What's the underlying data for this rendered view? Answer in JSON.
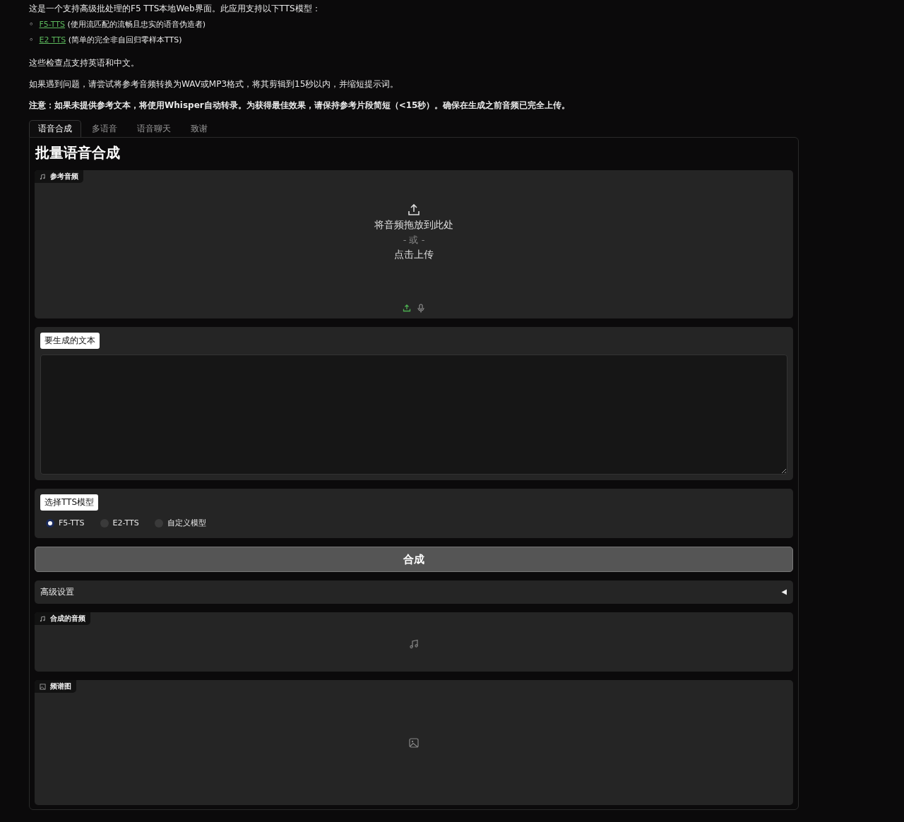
{
  "intro": {
    "paragraph": "这是一个支持高级批处理的F5 TTS本地Web界面。此应用支持以下TTS模型：",
    "models": [
      {
        "marker": "◦",
        "link": "F5-TTS",
        "description": "(使用流匹配的流畅且忠实的语音伪造者)"
      },
      {
        "marker": "◦",
        "link": "E2 TTS",
        "description": "(简单的完全非自回归零样本TTS)"
      }
    ],
    "notes": [
      {
        "kind": "plain",
        "text": "这些检查点支持英语和中文。"
      },
      {
        "kind": "plain",
        "text": "如果遇到问题，请尝试将参考音频转换为WAV或MP3格式，将其剪辑到15秒以内，并缩短提示词。"
      },
      {
        "kind": "bold",
        "text": "注意：如果未提供参考文本，将使用Whisper自动转录。为获得最佳效果，请保持参考片段简短（<15秒）。确保在生成之前音频已完全上传。"
      }
    ]
  },
  "tabs": [
    {
      "label": "语音合成",
      "selected": true
    },
    {
      "label": "多语音",
      "selected": false
    },
    {
      "label": "语音聊天",
      "selected": false
    },
    {
      "label": "致谢",
      "selected": false
    }
  ],
  "panel": {
    "title": "批量语音合成",
    "reference_audio": {
      "label": "参考音频",
      "drop_text": "将音频拖放到此处",
      "or_text": "- 或 -",
      "click_text": "点击上传"
    },
    "text_input": {
      "label": "要生成的文本"
    },
    "model_select": {
      "label": "选择TTS模型",
      "options": [
        {
          "label": "F5-TTS",
          "selected": true
        },
        {
          "label": "E2-TTS",
          "selected": false
        },
        {
          "label": "自定义模型",
          "selected": false
        }
      ]
    },
    "synthesize_button": "合成",
    "advanced": {
      "label": "高级设置",
      "expanded": false
    },
    "output_audio": {
      "label": "合成的音频"
    },
    "spectrogram": {
      "label": "频谱图"
    }
  }
}
